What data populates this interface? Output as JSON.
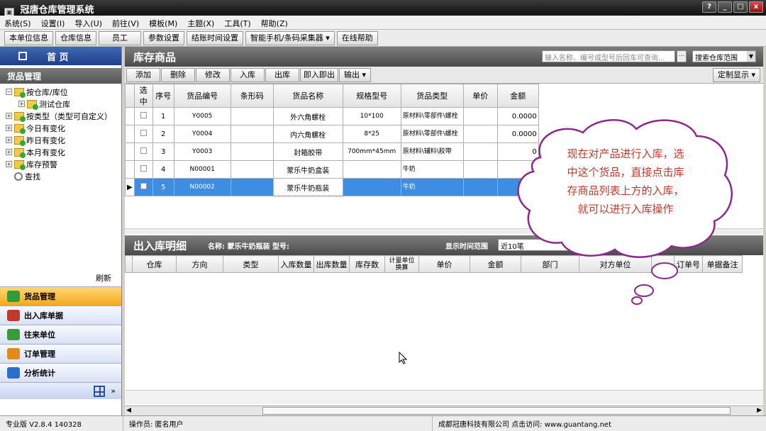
{
  "app": {
    "title": "冠唐仓库管理系统"
  },
  "window_buttons": {
    "help": "?",
    "min": "_",
    "max": "□",
    "close": "x"
  },
  "menu": [
    "系统(S)",
    "设置(I)",
    "导入(U)",
    "前往(V)",
    "模板(M)",
    "主题(X)",
    "工具(T)",
    "帮助(Z)"
  ],
  "toolbar": [
    "本单位信息",
    "仓库信息",
    "员工",
    "参数设置",
    "结账时间设置",
    "智能手机/条码采集器 ▾",
    "在线帮助"
  ],
  "sidebar": {
    "home_label": "首 页",
    "section_title": "货品管理",
    "tree": [
      {
        "label": "按仓库/库位",
        "pm": "−",
        "indent": 0
      },
      {
        "label": "测试仓库",
        "pm": "+",
        "indent": 1
      },
      {
        "label": "按类型（类型可自定义）",
        "pm": "+",
        "indent": 0
      },
      {
        "label": "今日有变化",
        "pm": "+",
        "indent": 0
      },
      {
        "label": "昨日有变化",
        "pm": "+",
        "indent": 0
      },
      {
        "label": "本月有变化",
        "pm": "+",
        "indent": 0
      },
      {
        "label": "库存预警",
        "pm": "+",
        "indent": 0
      },
      {
        "label": "查找",
        "pm": "",
        "indent": 0
      }
    ],
    "refresh_label": "刷新",
    "nav": [
      {
        "label": "货品管理",
        "color": "#2f9e3a",
        "active": true
      },
      {
        "label": "出入库单据",
        "color": "#c0392b",
        "active": false
      },
      {
        "label": "往来单位",
        "color": "#3a9b3a",
        "active": false
      },
      {
        "label": "订单管理",
        "color": "#e38b1a",
        "active": false
      },
      {
        "label": "分析统计",
        "color": "#2a6fc9",
        "active": false
      }
    ],
    "expand_glyph": "»"
  },
  "inventory": {
    "title": "库存商品",
    "search_placeholder": "输入名称、编号或型号后回车可查询...",
    "search_dots": "...",
    "scope_label": "搜索仓库范围",
    "actions": [
      "添加",
      "删除",
      "修改",
      "入库",
      "出库",
      "即入即出",
      "输出 ▾"
    ],
    "custom_display": "定制显示 ▾",
    "columns": [
      "选中",
      "序号",
      "货品编号",
      "条形码",
      "货品名称",
      "规格型号",
      "货品类型",
      "单价",
      "金额"
    ],
    "rows": [
      {
        "no": "1",
        "code": "Y0005",
        "barcode": "",
        "name": "外六角螺栓",
        "spec": "10*100",
        "type": "原材料\\零部件\\螺栓",
        "price": "",
        "amount": "0.0000"
      },
      {
        "no": "2",
        "code": "Y0004",
        "barcode": "",
        "name": "内六角螺栓",
        "spec": "8*25",
        "type": "原材料\\零部件\\螺栓",
        "price": "",
        "amount": "0.0000"
      },
      {
        "no": "3",
        "code": "Y0003",
        "barcode": "",
        "name": "封箱胶带",
        "spec": "700mm*45mm",
        "type": "原材料\\辅料\\胶带",
        "price": "",
        "amount": "0"
      },
      {
        "no": "4",
        "code": "N00001",
        "barcode": "",
        "name": "蒙乐牛奶盒装",
        "spec": "",
        "type": "牛奶",
        "price": "",
        "amount": "0"
      },
      {
        "no": "5",
        "code": "N00002",
        "barcode": "",
        "name": "蒙乐牛奶瓶装",
        "spec": "",
        "type": "牛奶",
        "price": "",
        "amount": "0."
      }
    ],
    "selected_row": 4
  },
  "detail": {
    "title": "出入库明细",
    "subtitle": "名称: 蒙乐牛奶瓶装  型号:",
    "range_label": "显示时间范围",
    "range_value": "近10笔",
    "columns": [
      "仓库",
      "方向",
      "类型",
      "入库数量",
      "出库数量",
      "库存数",
      "计量单位换算",
      "单价",
      "金额",
      "部门",
      "对方单位",
      "",
      "订单号",
      "单据备注"
    ]
  },
  "annotation": {
    "text": "现在对产品进行入库，选中这个货品，直接点击库存商品列表上方的入库，就可以进行入库操作",
    "lines": [
      "现在对产品进行入库，选",
      "中这个货品，直接点击库",
      "存商品列表上方的入库，",
      "就可以进行入库操作"
    ],
    "border_color": "#8b2a8b",
    "text_color": "#c0392b"
  },
  "status": {
    "edition": "专业版  V2.8.4 140328",
    "operator": "操作员: 匿名用户",
    "company": "成都冠唐科技有限公司 点击访问: www.guantang.net"
  }
}
